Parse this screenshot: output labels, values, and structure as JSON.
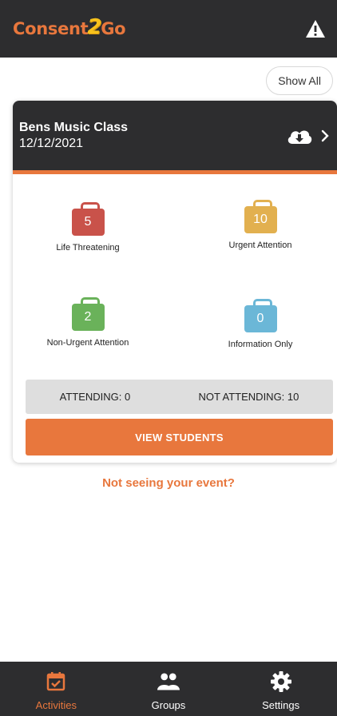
{
  "header": {
    "logo_left": "Consent",
    "logo_mid": "2",
    "logo_right": "Go",
    "alert_icon": "warning-triangle-icon"
  },
  "filter": {
    "show_all_label": "Show All"
  },
  "event": {
    "title": "Bens Music Class",
    "date": "12/12/2021",
    "cloud_icon": "cloud-download-icon",
    "chevron_icon": "chevron-right-icon",
    "categories": [
      {
        "label": "Life Threatening",
        "count": "5",
        "color": "#c9524a"
      },
      {
        "label": "Urgent Attention",
        "count": "10",
        "color": "#e2b04f"
      },
      {
        "label": "Non-Urgent Attention",
        "count": "2",
        "color": "#6ab25a"
      },
      {
        "label": "Information Only",
        "count": "0",
        "color": "#6bb7d7"
      }
    ],
    "attending": "ATTENDING: 0",
    "not_attending": "NOT ATTENDING: 10",
    "view_students_label": "VIEW STUDENTS"
  },
  "help": {
    "not_seeing_label": "Not seeing your event?"
  },
  "bottom_nav": {
    "items": [
      {
        "label": "Activities",
        "icon": "calendar-check-icon",
        "active": true
      },
      {
        "label": "Groups",
        "icon": "people-icon",
        "active": false
      },
      {
        "label": "Settings",
        "icon": "gear-icon",
        "active": false
      }
    ]
  },
  "colors": {
    "brand_orange": "#e8773d",
    "header_dark": "#2d2d2f",
    "logo_yellow": "#f7c21c"
  }
}
